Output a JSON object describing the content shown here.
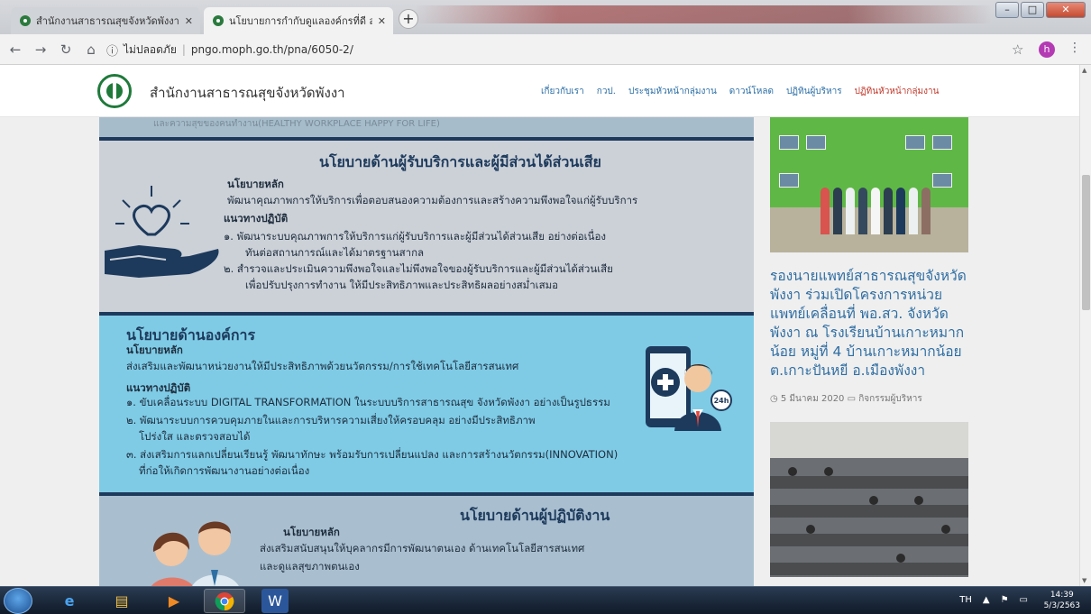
{
  "browser": {
    "tabs": [
      {
        "title": "สำนักงานสาธารณสุขจังหวัดพังงา",
        "active": false
      },
      {
        "title": "นโยบายการกำกับดูแลองค์กรที่ดี สำ",
        "active": true
      }
    ],
    "address": {
      "security_label": "ไม่ปลอดภัย",
      "url": "pngo.moph.go.th/pna/6050-2/"
    },
    "avatar_letter": "h"
  },
  "site": {
    "name": "สำนักงานสาธารณสุขจังหวัดพังงา",
    "menu": [
      "เกี่ยวกับเรา",
      "กวป.",
      "ประชุมหัวหน้ากลุ่มงาน",
      "ดาวน์โหลด",
      "ปฏิทินผู้บริหาร",
      "ปฏิทินหัวหน้ากลุ่มงาน"
    ]
  },
  "infographic": {
    "top_partial": "และความสุขของคนทำงาน(HEALTHY WORKPLACE HAPPY FOR LIFE)",
    "stakeholder": {
      "heading": "นโยบายด้านผู้รับบริการและผู้มีส่วนได้ส่วนเสีย",
      "main_label": "นโยบายหลัก",
      "main_text": "พัฒนาคุณภาพการให้บริการเพื่อตอบสนองความต้องการและสร้างความพึงพอใจแก่ผู้รับบริการ",
      "practice_label": "แนวทางปฏิบัติ",
      "item1_line1": "๑. พัฒนาระบบคุณภาพการให้บริการแก่ผู้รับบริการและผู้มีส่วนได้ส่วนเสีย อย่างต่อเนื่อง",
      "item1_line2": "ทันต่อสถานการณ์และได้มาตรฐานสากล",
      "item2_line1": "๒. สำรวจและประเมินความพึงพอใจและไม่พึงพอใจของผู้รับบริการและผู้มีส่วนได้ส่วนเสีย",
      "item2_line2": "เพื่อปรับปรุงการทำงาน ให้มีประสิทธิภาพและประสิทธิผลอย่างสม่ำเสมอ"
    },
    "organization": {
      "heading": "นโยบายด้านองค์การ",
      "main_label": "นโยบายหลัก",
      "main_text": "ส่งเสริมและพัฒนาหน่วยงานให้มีประสิทธิภาพด้วยนวัตกรรม/การใช้เทคโนโลยีสารสนเทศ",
      "practice_label": "แนวทางปฏิบัติ",
      "item1": "๑. ขับเคลื่อนระบบ DIGITAL TRANSFORMATION ในระบบบริการสาธารณสุข จังหวัดพังงา อย่างเป็นรูปธรรม",
      "item2_line1": "๒. พัฒนาระบบการควบคุมภายในและการบริหารความเสี่ยงให้ครอบคลุม อย่างมีประสิทธิภาพ",
      "item2_line2": "โปร่งใส และตรวจสอบได้",
      "item3_line1": "๓. ส่งเสริมการแลกเปลี่ยนเรียนรู้ พัฒนาทักษะ พร้อมรับการเปลี่ยนแปลง และการสร้างนวัตกรรม(INNOVATION)",
      "item3_line2": "ที่ก่อให้เกิดการพัฒนางานอย่างต่อเนื่อง",
      "badge": "24h"
    },
    "employee": {
      "heading": "นโยบายด้านผู้ปฏิบัติงาน",
      "main_label": "นโยบายหลัก",
      "main_text": "ส่งเสริมสนับสนุนให้บุคลากรมีการพัฒนาตนเอง ด้านเทคโนโลยีสารสนเทศ",
      "main_text2": "และดูแลสุขภาพตนเอง"
    }
  },
  "news": {
    "title": "รองนายแพทย์สาธารณสุขจังหวัดพังงา ร่วมเปิดโครงการหน่วยแพทย์เคลื่อนที่ พอ.สว. จังหวัดพังงา ณ โรงเรียนบ้านเกาะหมากน้อย หมู่ที่ 4 บ้านเกาะหมากน้อย ต.เกาะปันหยี อ.เมืองพังงา",
    "date": "5 มีนาคม 2020",
    "category": "กิจกรรมผู้บริหาร"
  },
  "taskbar": {
    "lang": "TH",
    "time": "14:39",
    "date": "5/3/2563"
  },
  "colors": {
    "accent": "#2f6ea3",
    "heading": "#1d3a5c",
    "band_org": "#7fcbe6"
  }
}
